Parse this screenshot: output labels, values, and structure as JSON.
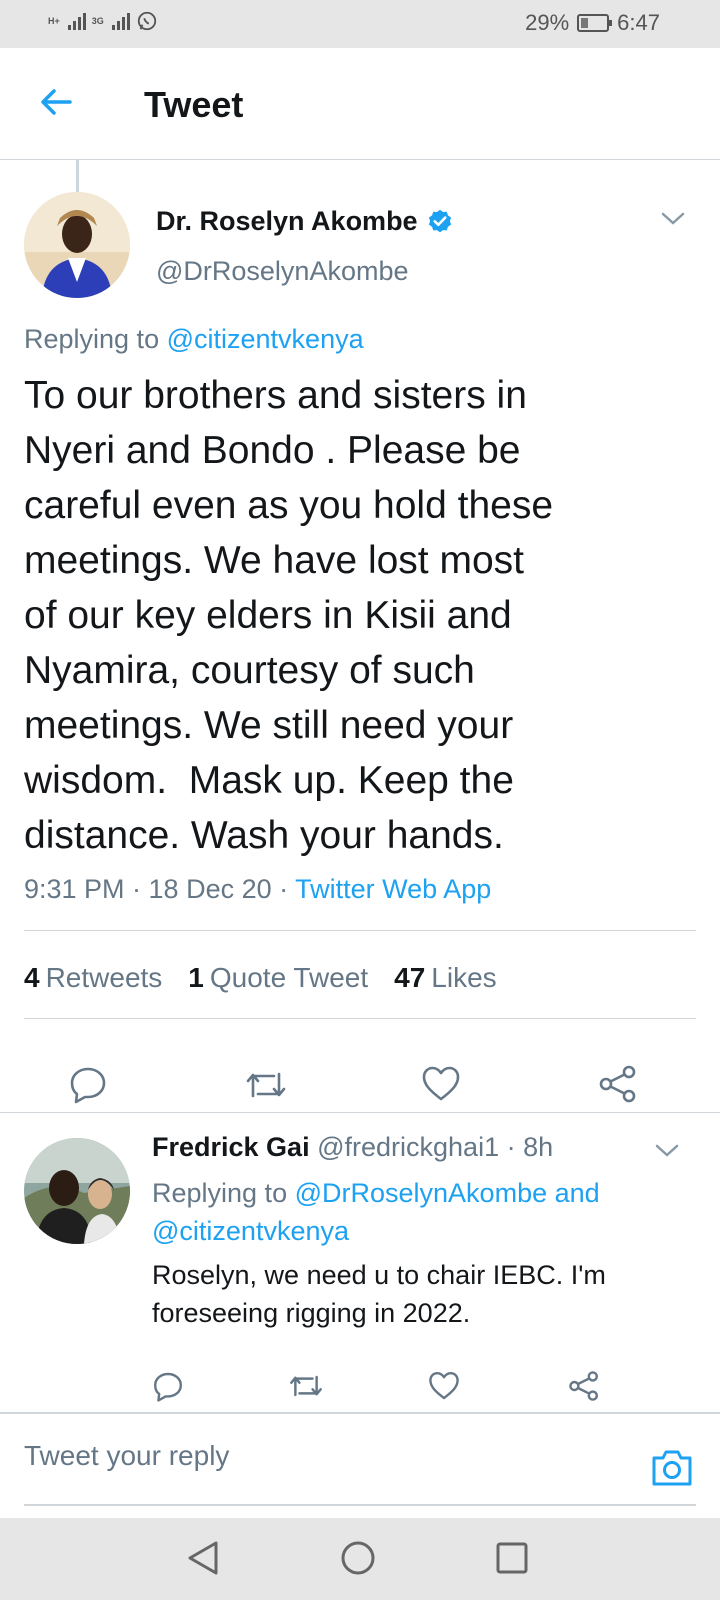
{
  "status_bar": {
    "net1": "H+",
    "net2": "3G",
    "battery_percent_text": "29%",
    "battery_level": 0.29,
    "time": "6:47",
    "icons": [
      "signal-icon",
      "signal-icon",
      "whatsapp-icon",
      "battery-icon"
    ]
  },
  "header": {
    "title": "Tweet",
    "back_icon": "arrow-left-icon"
  },
  "tweet": {
    "author_name": "Dr. Roselyn Akombe",
    "verified": true,
    "handle": "@DrRoselynAkombe",
    "replying_prefix": "Replying to",
    "replying_to": "@citizentvkenya",
    "text": "To our brothers and sisters in\nNyeri and Bondo . Please be\ncareful even as you hold these\nmeetings. We have lost most\nof our key elders in Kisii and\nNyamira, courtesy of such\nmeetings. We still need your\nwisdom.  Mask up. Keep the\ndistance. Wash your hands.",
    "timestamp": "9:31 PM · 18 Dec 20 · ",
    "source": "Twitter Web App",
    "retweets_count": "4",
    "retweets_label": "Retweets",
    "quotes_count": "1",
    "quotes_label": "Quote Tweet",
    "likes_count": "47",
    "likes_label": "Likes"
  },
  "reply": {
    "author_name": "Fredrick Gai",
    "handle_time": "@fredrickghai1 · 8h",
    "replying_prefix": "Replying to",
    "replying_to": "@DrRoselynAkombe and @citizentvkenya",
    "text": "Roselyn, we need u to chair IEBC. I'm foreseeing rigging in 2022."
  },
  "composer": {
    "placeholder": "Tweet your reply"
  },
  "colors": {
    "accent": "#1da1f2",
    "secondary_text": "#657786",
    "divider": "#d0d6da",
    "system_bar": "#e6e6e6"
  }
}
